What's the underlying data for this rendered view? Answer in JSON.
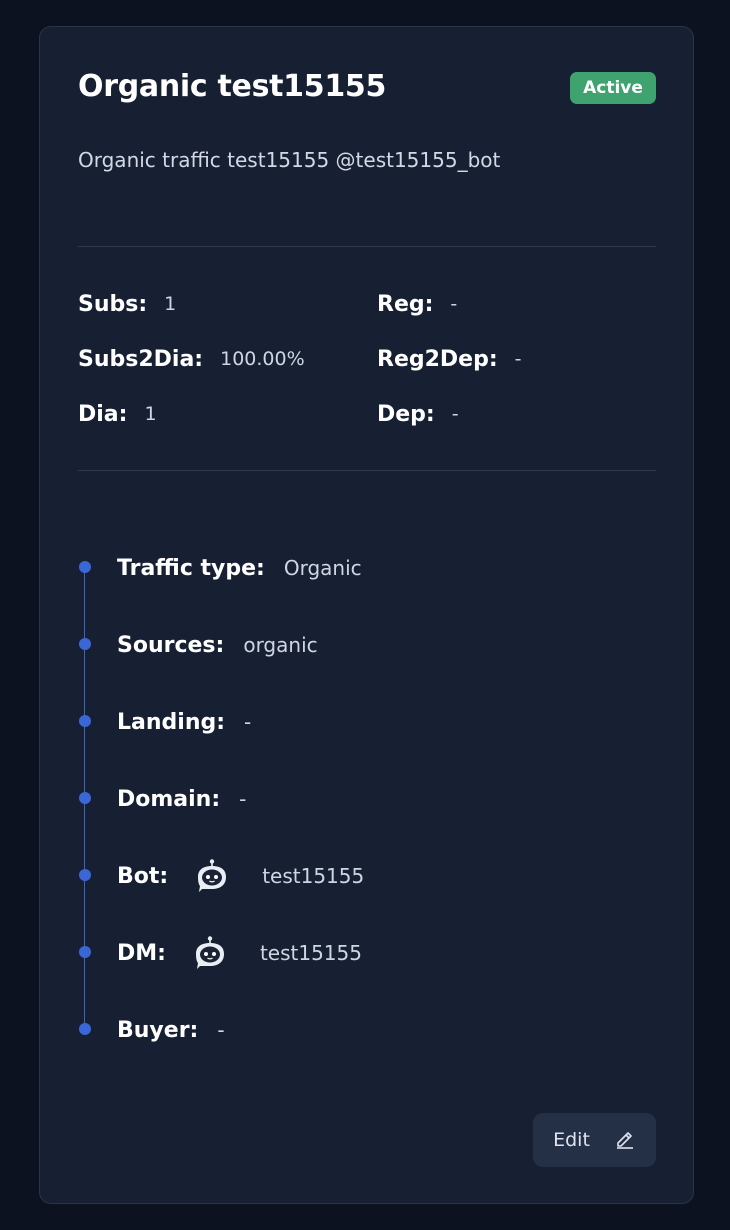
{
  "card": {
    "title": "Organic test15155",
    "status": "Active",
    "status_color": "#3fa36f",
    "description": "Organic traffic test15155 @test15155_bot"
  },
  "stats": {
    "subs": {
      "label": "Subs:",
      "value": "1"
    },
    "subs2dia": {
      "label": "Subs2Dia:",
      "value": "100.00%"
    },
    "dia": {
      "label": "Dia:",
      "value": "1"
    },
    "reg": {
      "label": "Reg:",
      "value": "-"
    },
    "reg2dep": {
      "label": "Reg2Dep:",
      "value": "-"
    },
    "dep": {
      "label": "Dep:",
      "value": "-"
    }
  },
  "details": {
    "traffic_type": {
      "label": "Traffic type:",
      "value": "Organic"
    },
    "sources": {
      "label": "Sources:",
      "value": "organic"
    },
    "landing": {
      "label": "Landing:",
      "value": "-"
    },
    "domain": {
      "label": "Domain:",
      "value": "-"
    },
    "bot": {
      "label": "Bot:",
      "icon": "robot-chat-icon",
      "value": "test15155"
    },
    "dm": {
      "label": "DM:",
      "icon": "robot-chat-icon",
      "value": "test15155"
    },
    "buyer": {
      "label": "Buyer:",
      "value": "-"
    }
  },
  "actions": {
    "edit_label": "Edit",
    "edit_icon": "pencil-icon"
  },
  "colors": {
    "background": "#0c1220",
    "card": "#172033",
    "accent_dot": "#3b67d6"
  }
}
